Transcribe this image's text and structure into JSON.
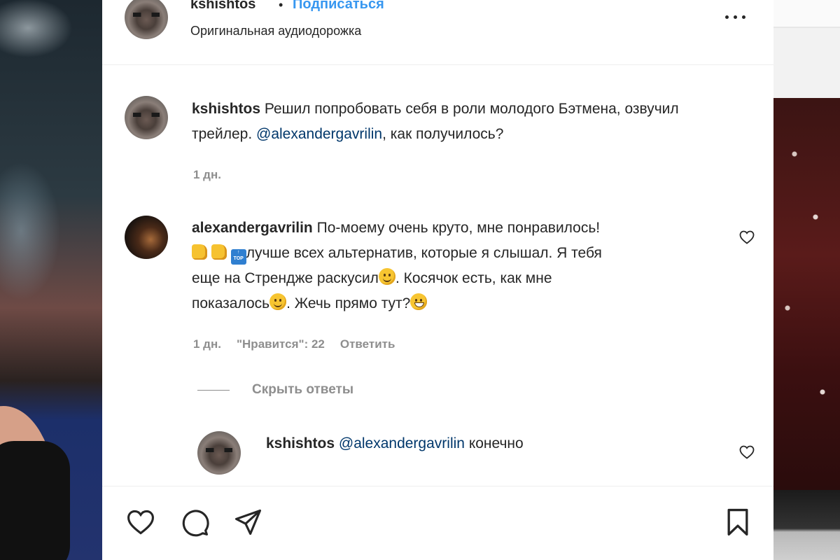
{
  "post": {
    "author": "kshishtos",
    "separator": "•",
    "follow_label": "Подписаться",
    "audio_label": "Оригинальная аудиодорожка"
  },
  "caption": {
    "user": "kshishtos",
    "text": "Решил попробовать себя в роли молодого Бэтмена, озвучил трейлер.",
    "mention": "@alexandergavrilin",
    "text_after": ", как получилось?",
    "time": "1 дн."
  },
  "comments": [
    {
      "user": "alexandergavrilin",
      "line1": "По-моему очень круто, мне понравилось!",
      "line2": "лучше всех альтернатив, которые я слышал. Я тебя",
      "line3": "еще на Стрендже раскусил",
      "line3b": ". Косячок есть, как мне",
      "line4": "показалось",
      "line4b": ". Жечь прямо тут?",
      "time": "1 дн.",
      "likes": "\"Нравится\": 22",
      "reply_label": "Ответить",
      "hide_replies_label": "Скрыть ответы",
      "emoji_top_text": "TOP"
    }
  ],
  "reply": {
    "user": "kshishtos",
    "mention": "@alexandergavrilin",
    "text": "конечно"
  },
  "icons": {
    "more": "more-options-icon",
    "like": "heart-icon",
    "comment": "comment-icon",
    "share": "share-icon",
    "save": "bookmark-icon"
  },
  "colors": {
    "link_blue": "#3797f0",
    "mention": "#00376b",
    "text": "#262626",
    "muted": "#8e8e8e"
  }
}
